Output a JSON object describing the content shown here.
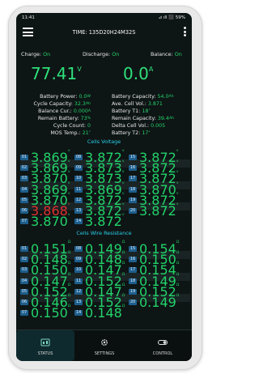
{
  "status_bar": {
    "time": "11:41",
    "indicators": "⊿ ıll ⬛ 59%"
  },
  "header": {
    "title": "TIME: 135D20H24M32S"
  },
  "switches": {
    "charge_label": "Charge:",
    "charge_value": "On",
    "discharge_label": "Discharge:",
    "discharge_value": "On",
    "balance_label": "Balance:",
    "balance_value": "On"
  },
  "readout": {
    "voltage": "77.41",
    "voltage_unit": "V",
    "current": "0.0",
    "current_unit": "A"
  },
  "left_info": [
    {
      "label": "Battery Power:",
      "value": "0.0",
      "unit": "W"
    },
    {
      "label": "Cycle Capacity:",
      "value": "32.3",
      "unit": "Ah"
    },
    {
      "label": "Balance Cur.:",
      "value": "0.000",
      "unit": "A"
    },
    {
      "label": "Remain Battery:",
      "value": "73",
      "unit": "%"
    },
    {
      "label": "Cycle Count:",
      "value": "0",
      "unit": ""
    },
    {
      "label": "MOS Temp.:",
      "value": "21",
      "unit": "°"
    }
  ],
  "right_info": [
    {
      "label": "Battery Capacity:",
      "value": "54.0",
      "unit": "Ah"
    },
    {
      "label": "Ave. Cell Vol.:",
      "value": "3.871",
      "unit": ""
    },
    {
      "label": "Battery T1:",
      "value": "18",
      "unit": "°"
    },
    {
      "label": "Remain Capacity:",
      "value": "39.4",
      "unit": "Ah"
    },
    {
      "label": "Delta Cell Vol.:",
      "value": "0.005",
      "unit": ""
    },
    {
      "label": "Battery T2:",
      "value": "17",
      "unit": "°"
    }
  ],
  "cells_voltage": {
    "title": "Cells Voltage",
    "col1": [
      {
        "n": "01",
        "v": "3.869"
      },
      {
        "n": "02",
        "v": "3.869"
      },
      {
        "n": "03",
        "v": "3.870"
      },
      {
        "n": "04",
        "v": "3.869"
      },
      {
        "n": "05",
        "v": "3.870"
      },
      {
        "n": "06",
        "v": "3.868",
        "low": true
      },
      {
        "n": "07",
        "v": "3.870"
      }
    ],
    "col2": [
      {
        "n": "08",
        "v": "3.872"
      },
      {
        "n": "09",
        "v": "3.873"
      },
      {
        "n": "10",
        "v": "3.873"
      },
      {
        "n": "11",
        "v": "3.869"
      },
      {
        "n": "12",
        "v": "3.872"
      },
      {
        "n": "13",
        "v": "3.872"
      },
      {
        "n": "14",
        "v": "3.872"
      }
    ],
    "col3": [
      {
        "n": "15",
        "v": "3.872"
      },
      {
        "n": "16",
        "v": "3.872"
      },
      {
        "n": "17",
        "v": "3.872"
      },
      {
        "n": "18",
        "v": "3.870"
      },
      {
        "n": "19",
        "v": "3.872"
      },
      {
        "n": "20",
        "v": "3.872"
      }
    ]
  },
  "cells_resistance": {
    "title": "Cells Wire Resistance",
    "col1": [
      {
        "n": "01",
        "v": "0.151"
      },
      {
        "n": "02",
        "v": "0.148"
      },
      {
        "n": "03",
        "v": "0.150"
      },
      {
        "n": "04",
        "v": "0.147"
      },
      {
        "n": "05",
        "v": "0.152"
      },
      {
        "n": "06",
        "v": "0.146"
      },
      {
        "n": "07",
        "v": "0.150"
      }
    ],
    "col2": [
      {
        "n": "08",
        "v": "0.149"
      },
      {
        "n": "09",
        "v": "0.148"
      },
      {
        "n": "10",
        "v": "0.147"
      },
      {
        "n": "11",
        "v": "0.152"
      },
      {
        "n": "12",
        "v": "0.147"
      },
      {
        "n": "13",
        "v": "0.152"
      },
      {
        "n": "14",
        "v": "0.148"
      }
    ],
    "col3": [
      {
        "n": "15",
        "v": "0.154"
      },
      {
        "n": "16",
        "v": "0.150"
      },
      {
        "n": "17",
        "v": "0.154"
      },
      {
        "n": "18",
        "v": "0.149"
      },
      {
        "n": "19",
        "v": "0.152"
      },
      {
        "n": "20",
        "v": "0.149"
      }
    ]
  },
  "bottom_nav": [
    {
      "label": "STATUS",
      "icon": "status-icon",
      "active": true
    },
    {
      "label": "SETTINGS",
      "icon": "gear-icon",
      "active": false
    },
    {
      "label": "CONTROL",
      "icon": "toggle-icon",
      "active": false
    }
  ],
  "colors": {
    "value_green": "#22d36a",
    "section_cyan": "#28cfe6",
    "index_blue": "#1d5e8c",
    "low_red": "#e03030"
  }
}
